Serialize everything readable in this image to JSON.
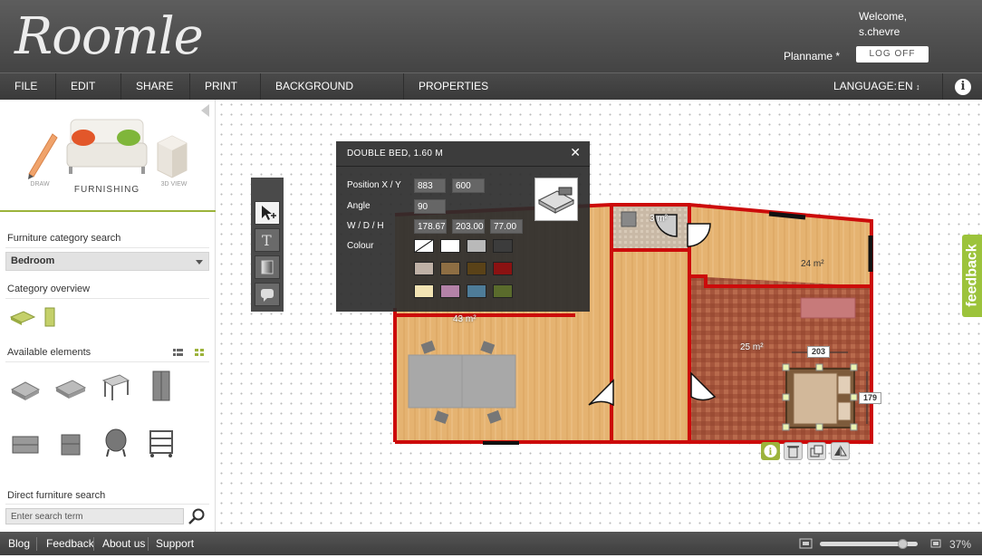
{
  "header": {
    "logo": "Roomle",
    "welcome_line1": "Welcome,",
    "welcome_line2": "s.chevre",
    "planname": "Planname *",
    "logoff_label": "LOG OFF"
  },
  "menu": {
    "items": [
      "FILE",
      "EDIT",
      "SHARE",
      "PRINT",
      "BACKGROUND IMAGE",
      "PROPERTIES"
    ],
    "language_label": "LANGUAGE:",
    "language_value": "EN"
  },
  "sidebar": {
    "modes": [
      "DRAW",
      "FURNISHING",
      "3D VIEW"
    ],
    "category_search_label": "Furniture category search",
    "category_selected": "Bedroom",
    "category_overview_label": "Category overview",
    "available_label": "Available elements",
    "direct_search_label": "Direct furniture search",
    "search_placeholder": "Enter search term"
  },
  "dialog": {
    "title": "DOUBLE BED, 1.60 M",
    "position_label": "Position X / Y",
    "pos_x": "883",
    "pos_y": "600",
    "angle_label": "Angle",
    "angle": "90",
    "wdh_label": "W / D / H",
    "w": "178.67",
    "d": "203.00",
    "h": "77.00",
    "colour_label": "Colour",
    "colours": [
      "#ffffff",
      "#b9b9b9",
      "#3c3c3c",
      "#bfb1a6",
      "#8e6e43",
      "#5a4218",
      "#8b1212",
      "#f2e3b3",
      "#b482a8",
      "#4e7c98",
      "#5a6b2c"
    ]
  },
  "plan": {
    "room_labels": [
      "43 m²",
      "3 m²",
      "24 m²",
      "25 m²"
    ],
    "dim_width": "203",
    "dim_height": "179"
  },
  "feedback_label": "feedback",
  "footer": {
    "links": [
      "Blog",
      "Feedback",
      "About us",
      "Support"
    ],
    "zoom": "37%"
  }
}
